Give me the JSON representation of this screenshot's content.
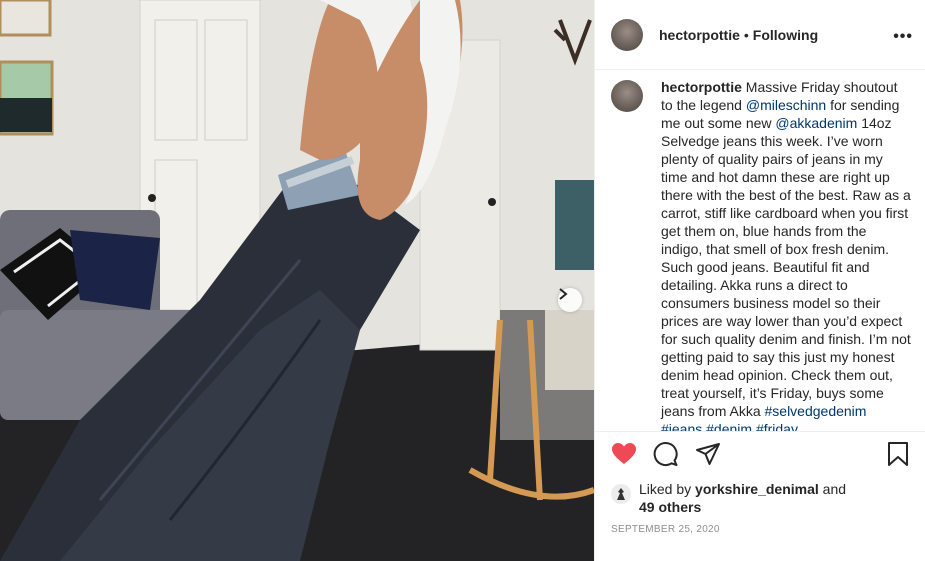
{
  "post": {
    "username": "hectorpottie",
    "separator": "•",
    "follow_status": "Following",
    "more_label": "•••"
  },
  "caption": {
    "username": "hectorpottie",
    "text_1": " Massive Friday shoutout to the legend ",
    "mention_1": "@mileschinn",
    "text_2": " for sending me out some new ",
    "mention_2": "@akkadenim",
    "text_3": " 14oz Selvedge jeans this week. I’ve worn plenty of quality pairs of jeans in my time and hot damn these are right up there with the best of the best. Raw as a carrot, stiff like cardboard when you first get them on, blue hands from the indigo, that smell of box fresh denim. Such good jeans. Beautiful fit and detailing. Akka runs a direct to consumers business model so their prices are way lower than you’d expect for such quality denim and finish. I’m not getting paid to say this just my honest denim head opinion. Check them out, treat yourself, it’s Friday, buys some jeans from Akka ",
    "hashtags": "#selvedgedenim #jeans #denim #friday"
  },
  "likes": {
    "prefix": "Liked by ",
    "liker": "yorkshire_denimal",
    "and": " and",
    "others": "49 others"
  },
  "date": "SEPTEMBER 25, 2020",
  "icons": {
    "like": "heart-icon",
    "comment": "comment-icon",
    "share": "share-icon",
    "save": "bookmark-icon",
    "next": "chevron-right-icon"
  },
  "colors": {
    "heart": "#ed4956",
    "mention": "#00376b",
    "muted": "#8e8e8e"
  }
}
